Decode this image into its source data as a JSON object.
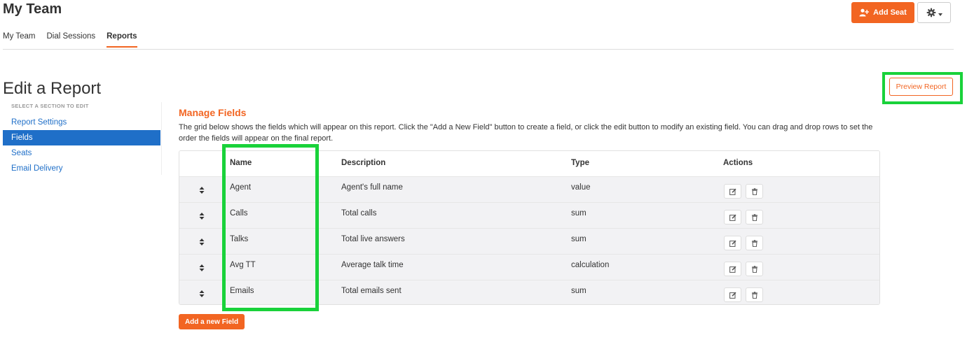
{
  "header": {
    "title": "My Team",
    "add_seat_label": "Add Seat"
  },
  "nav": {
    "tabs": [
      {
        "label": "My Team",
        "active": false
      },
      {
        "label": "Dial Sessions",
        "active": false
      },
      {
        "label": "Reports",
        "active": true
      }
    ]
  },
  "page": {
    "title": "Edit a Report",
    "preview_label": "Preview Report"
  },
  "sidebar": {
    "caption": "SELECT A SECTION TO EDIT",
    "items": [
      {
        "label": "Report Settings",
        "active": false
      },
      {
        "label": "Fields",
        "active": true
      },
      {
        "label": "Seats",
        "active": false
      },
      {
        "label": "Email Delivery",
        "active": false
      }
    ]
  },
  "fields": {
    "title": "Manage Fields",
    "description": "The grid below shows the fields which will appear on this report. Click the \"Add a New Field\" button to create a field, or click the edit button to modify an existing field. You can drag and drop rows to set the order the fields will appear on the final report.",
    "columns": {
      "name": "Name",
      "description": "Description",
      "type": "Type",
      "actions": "Actions"
    },
    "rows": [
      {
        "name": "Agent",
        "description": "Agent's full name",
        "type": "value"
      },
      {
        "name": "Calls",
        "description": "Total calls",
        "type": "sum"
      },
      {
        "name": "Talks",
        "description": "Total live answers",
        "type": "sum"
      },
      {
        "name": "Avg TT",
        "description": "Average talk time",
        "type": "calculation"
      },
      {
        "name": "Emails",
        "description": "Total emails sent",
        "type": "sum"
      }
    ],
    "add_label": "Add a new Field"
  },
  "colors": {
    "accent": "#f26522",
    "link": "#1f6fc8",
    "highlight": "#19d23a"
  },
  "icons": {
    "add_seat": "user-plus-icon",
    "settings": "gear-icon",
    "sort": "sort-handle-icon",
    "edit": "edit-icon",
    "delete": "trash-icon"
  }
}
